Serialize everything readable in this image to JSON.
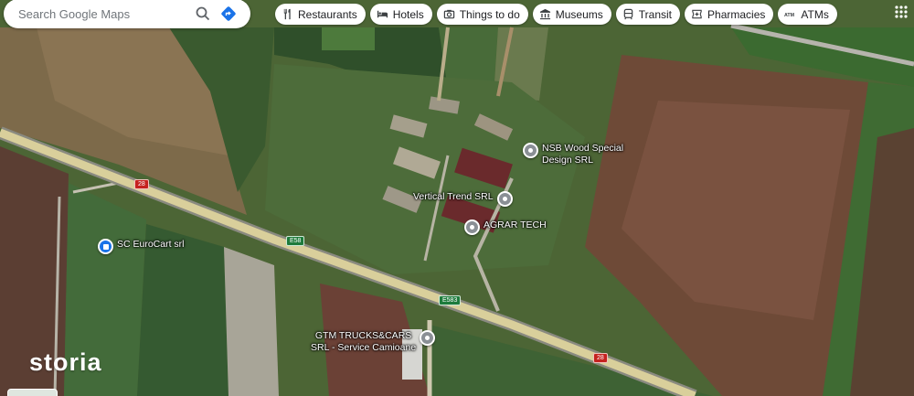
{
  "search": {
    "placeholder": "Search Google Maps"
  },
  "chips": [
    {
      "label": "Restaurants",
      "icon": "restaurant-icon"
    },
    {
      "label": "Hotels",
      "icon": "hotel-icon"
    },
    {
      "label": "Things to do",
      "icon": "camera-icon"
    },
    {
      "label": "Museums",
      "icon": "museum-icon"
    },
    {
      "label": "Transit",
      "icon": "transit-icon"
    },
    {
      "label": "Pharmacies",
      "icon": "pharmacy-icon"
    },
    {
      "label": "ATMs",
      "icon": "atm-icon"
    }
  ],
  "places": [
    {
      "name_line1": "NSB Wood Special",
      "name_line2": "Design SRL"
    },
    {
      "name": "Vertical Trend SRL"
    },
    {
      "name": "AGRAR TECH"
    },
    {
      "name": "SC EuroCart srl"
    },
    {
      "name_line1": "GTM TRUCKS&CARS",
      "name_line2": "SRL - Service Camioane"
    }
  ],
  "road_signs": {
    "r1": "28",
    "r2": "E58",
    "r3": "E583",
    "r4": "28"
  },
  "watermark": "storia",
  "colors": {
    "chip_bg": "#ffffff",
    "directions": "#1a73e8",
    "road": "#d9cf9b",
    "pin": "#8a8f95",
    "pin_blue": "#1a73e8"
  }
}
